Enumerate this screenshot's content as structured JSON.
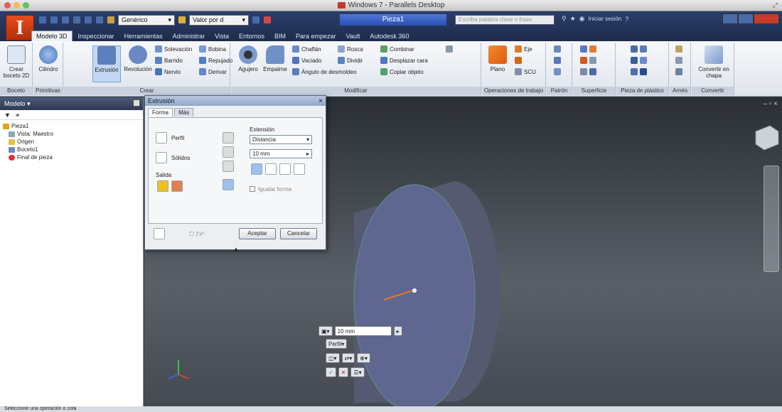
{
  "host_window": {
    "title": "Windows 7 - Parallels Desktop"
  },
  "app": {
    "document_title": "Pieza1",
    "search_placeholder": "Escriba palabra clave o frase",
    "signin_label": "Iniciar sesión",
    "qat": {
      "material_value": "Genérico",
      "appearance_value": "Valor por d"
    }
  },
  "ribbon": {
    "tabs": [
      "Modelo 3D",
      "Inspeccionar",
      "Herramientas",
      "Administrar",
      "Vista",
      "Entornos",
      "BIM",
      "Para empezar",
      "Vault",
      "Autodesk 360"
    ],
    "active_tab": "Modelo 3D",
    "panels": {
      "boceto": {
        "title": "Boceto",
        "crear_boceto": "Crear boceto 2D"
      },
      "primitivas": {
        "title": "Primitivas",
        "cilindro": "Cilindro"
      },
      "crear": {
        "title": "Crear",
        "extrusion": "Extrusión",
        "revolucion": "Revolución",
        "small": [
          "Solevación",
          "Barrido",
          "Nervio",
          "Bobina",
          "Repujado",
          "Derivar"
        ]
      },
      "modificar": {
        "title": "Modificar",
        "agujero": "Agujero",
        "empalme": "Empalme",
        "small": [
          "Chaflán",
          "Vaciado",
          "Ángulo de desmoldeo",
          "Rosca",
          "Dividir",
          "Combinar",
          "Desplazar cara",
          "Copiar objeto"
        ]
      },
      "operaciones": {
        "title": "Operaciones de trabajo",
        "plano": "Plano",
        "eje": "Eje",
        "ucs": "SCU"
      },
      "patron": {
        "title": "Patrón"
      },
      "superficie": {
        "title": "Superficie"
      },
      "plastico": {
        "title": "Pieza de plástico"
      },
      "arnes": {
        "title": "Arnés"
      },
      "convertir": {
        "title": "Convertir",
        "label": "Convertir en chapa"
      }
    }
  },
  "browser": {
    "title": "Modelo",
    "tree": [
      "Pieza1",
      "Vista: Maestro",
      "Origen",
      "Boceto1",
      "Final de pieza"
    ]
  },
  "dialog": {
    "title": "Extrusión",
    "tabs": [
      "Forma",
      "Más"
    ],
    "perfil": "Perfil",
    "solidos": "Sólidos",
    "salida": "Salida",
    "extension_label": "Extensión",
    "extension_value": "Distancia",
    "distance_value": "10 mm",
    "igualar_forma": "Igualar forma",
    "aceptar": "Aceptar",
    "cancelar": "Cancelar"
  },
  "viewport": {
    "minitoolbar_distance": "10 mm",
    "minitoolbar_perfil": "Perfil"
  },
  "status": {
    "text": "Seleccione una operación o cota"
  },
  "colors": {
    "accent": "#2a4fb0",
    "model_face": "#5f6690",
    "edge_highlight": "#3fbf3f",
    "ribbon_select": "#c3d7f2"
  }
}
